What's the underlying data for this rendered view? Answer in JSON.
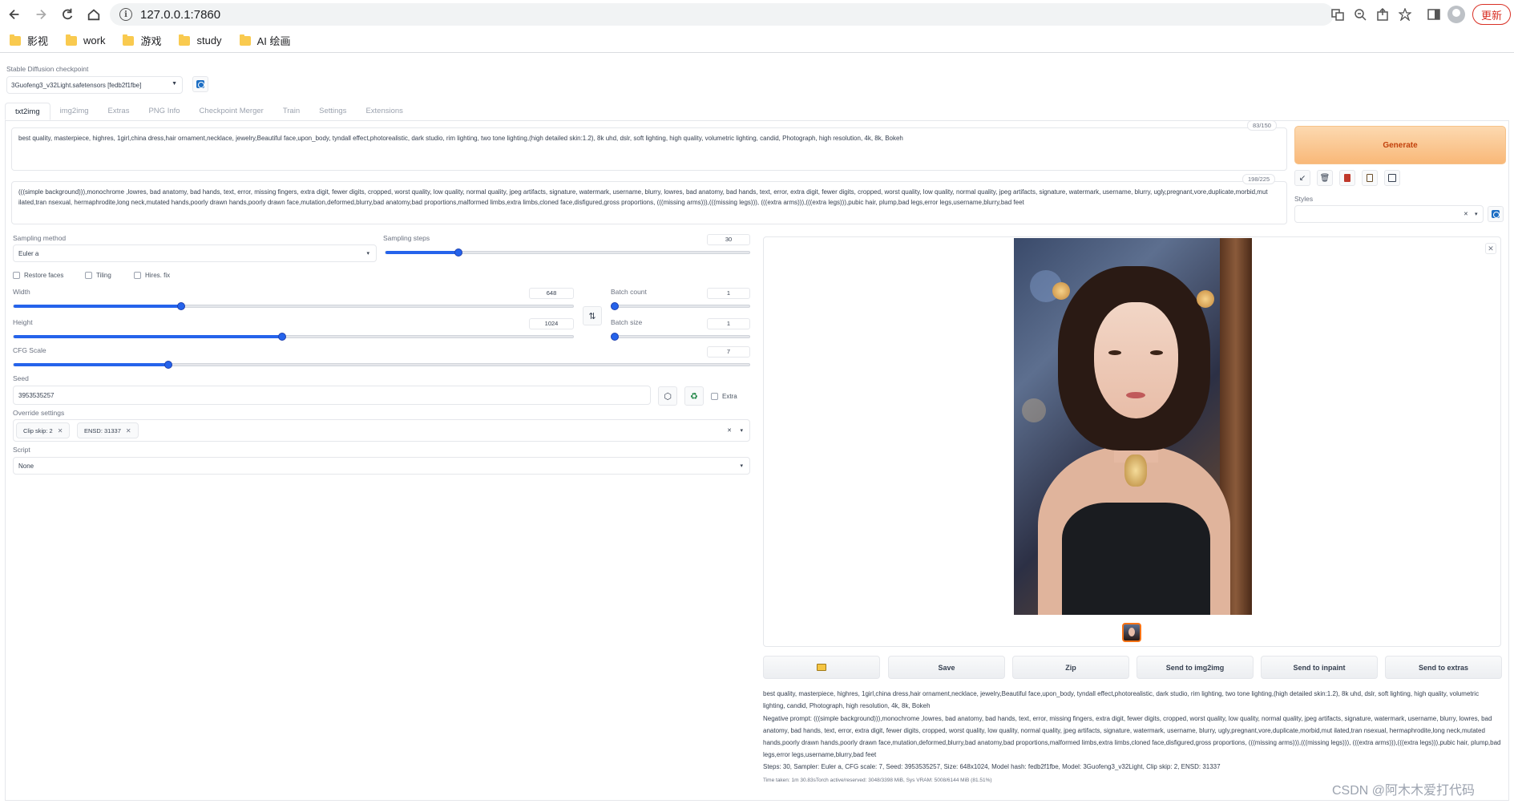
{
  "browser": {
    "url": "127.0.0.1:7860",
    "update_label": "更新",
    "bookmarks": [
      "影视",
      "work",
      "游戏",
      "study",
      "AI 绘画"
    ]
  },
  "checkpoint": {
    "label": "Stable Diffusion checkpoint",
    "value": "3Guofeng3_v32Light.safetensors [fedb2f1fbe]"
  },
  "tabs": [
    "txt2img",
    "img2img",
    "Extras",
    "PNG Info",
    "Checkpoint Merger",
    "Train",
    "Settings",
    "Extensions"
  ],
  "prompt": {
    "text": "best quality, masterpiece, highres, 1girl,china dress,hair ornament,necklace, jewelry,Beautiful face,upon_body, tyndall effect,photorealistic, dark studio, rim lighting, two tone lighting,(high detailed skin:1.2), 8k uhd, dslr, soft lighting, high quality, volumetric lighting, candid, Photograph, high resolution, 4k, 8k, Bokeh",
    "counter": "83/150"
  },
  "negative_prompt": {
    "text": "(((simple background))),monochrome ,lowres, bad anatomy, bad hands, text, error, missing fingers, extra digit, fewer digits, cropped, worst quality, low quality, normal quality, jpeg artifacts, signature, watermark, username, blurry, lowres, bad anatomy, bad hands, text, error, extra digit, fewer digits, cropped, worst quality, low quality, normal quality, jpeg artifacts, signature, watermark, username, blurry, ugly,pregnant,vore,duplicate,morbid,mut ilated,tran nsexual, hermaphrodite,long neck,mutated hands,poorly drawn hands,poorly drawn face,mutation,deformed,blurry,bad anatomy,bad proportions,malformed limbs,extra limbs,cloned face,disfigured,gross proportions, (((missing arms))),(((missing legs))), (((extra arms))),(((extra legs))),pubic hair, plump,bad legs,error legs,username,blurry,bad feet",
    "counter": "198/225"
  },
  "generate_label": "Generate",
  "styles_label": "Styles",
  "sampling": {
    "method_label": "Sampling method",
    "method_value": "Euler a",
    "steps_label": "Sampling steps",
    "steps_value": "30",
    "steps_fraction": 0.2
  },
  "checkboxes": [
    "Restore faces",
    "Tiling",
    "Hires. fix"
  ],
  "width": {
    "label": "Width",
    "value": "648",
    "fraction": 0.3
  },
  "height": {
    "label": "Height",
    "value": "1024",
    "fraction": 0.48
  },
  "batch_count": {
    "label": "Batch count",
    "value": "1"
  },
  "batch_size": {
    "label": "Batch size",
    "value": "1"
  },
  "cfg": {
    "label": "CFG Scale",
    "value": "7",
    "fraction": 0.21
  },
  "seed": {
    "label": "Seed",
    "value": "3953535257",
    "extra_label": "Extra"
  },
  "override": {
    "label": "Override settings",
    "chips": [
      "Clip skip: 2",
      "ENSD: 31337"
    ]
  },
  "script": {
    "label": "Script",
    "value": "None"
  },
  "output_buttons": [
    "Save",
    "Zip",
    "Send to img2img",
    "Send to inpaint",
    "Send to extras"
  ],
  "info": {
    "prompt": "best quality, masterpiece, highres, 1girl,china dress,hair ornament,necklace, jewelry,Beautiful face,upon_body, tyndall effect,photorealistic, dark studio, rim lighting, two tone lighting,(high detailed skin:1.2), 8k uhd, dslr, soft lighting, high quality, volumetric lighting, candid, Photograph, high resolution, 4k, 8k, Bokeh",
    "negative": "Negative prompt: (((simple background))),monochrome ,lowres, bad anatomy, bad hands, text, error, missing fingers, extra digit, fewer digits, cropped, worst quality, low quality, normal quality, jpeg artifacts, signature, watermark, username, blurry, lowres, bad anatomy, bad hands, text, error, extra digit, fewer digits, cropped, worst quality, low quality, normal quality, jpeg artifacts, signature, watermark, username, blurry, ugly,pregnant,vore,duplicate,morbid,mut ilated,tran nsexual, hermaphrodite,long neck,mutated hands,poorly drawn hands,poorly drawn face,mutation,deformed,blurry,bad anatomy,bad proportions,malformed limbs,extra limbs,cloned face,disfigured,gross proportions, (((missing arms))),(((missing legs))), (((extra arms))),(((extra legs))),pubic hair, plump,bad legs,error legs,username,blurry,bad feet",
    "params": "Steps: 30, Sampler: Euler a, CFG scale: 7, Seed: 3953535257, Size: 648x1024, Model hash: fedb2f1fbe, Model: 3Guofeng3_v32Light, Clip skip: 2, ENSD: 31337",
    "time": "Time taken: 1m 30.83sTorch active/reserved: 3048/3398 MiB, Sys VRAM: 5008/6144 MiB (81.51%)"
  },
  "watermark": "CSDN @阿木木爱打代码",
  "colors": {
    "accent": "#2563eb",
    "generate": "#f9b878",
    "update": "#d93025"
  }
}
